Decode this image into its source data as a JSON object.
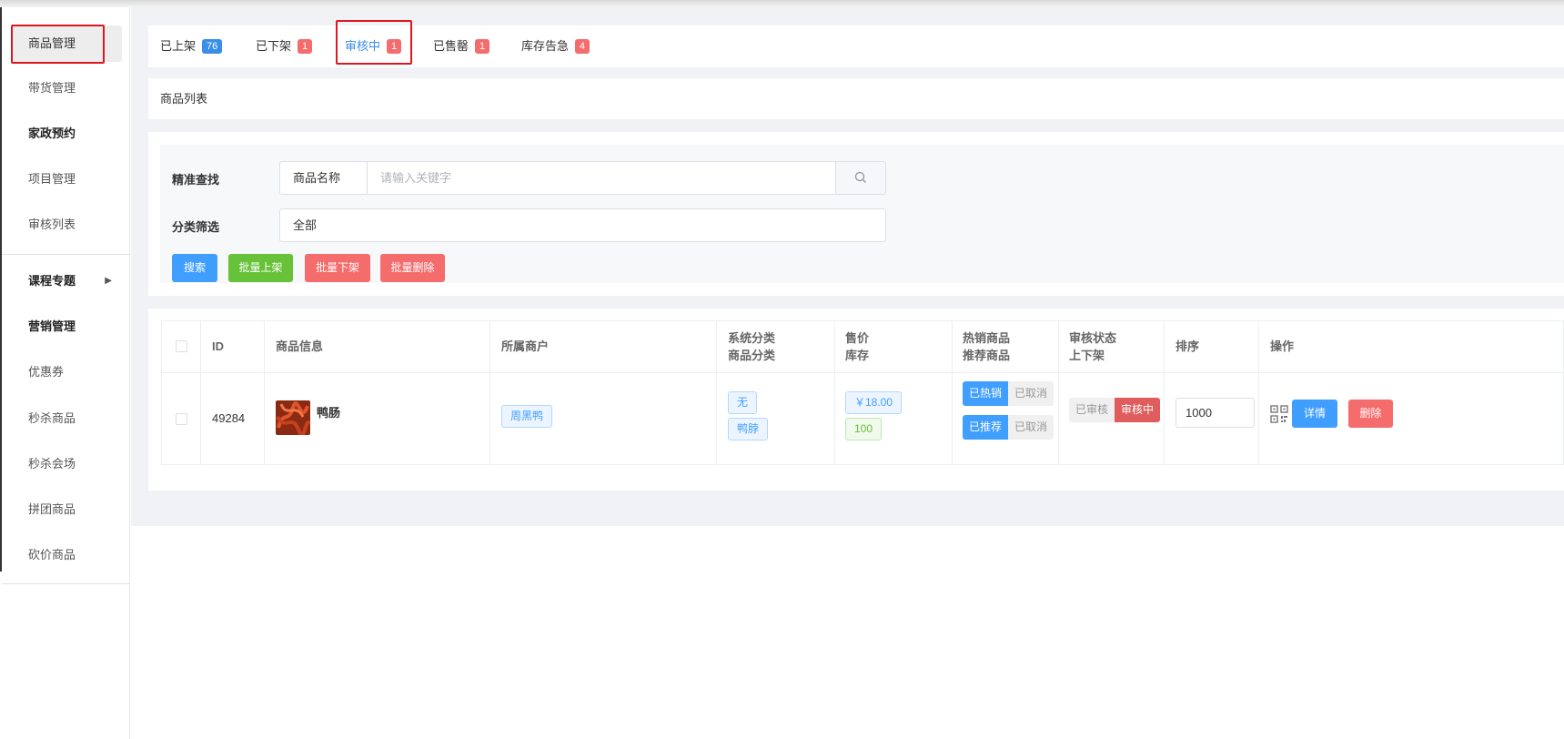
{
  "sidebar": {
    "items": [
      {
        "label": "商品管理"
      },
      {
        "label": "带货管理"
      },
      {
        "label": "家政预约"
      },
      {
        "label": "项目管理"
      },
      {
        "label": "审核列表"
      },
      {
        "label": "课程专题"
      },
      {
        "label": "营销管理"
      },
      {
        "label": "优惠券"
      },
      {
        "label": "秒杀商品"
      },
      {
        "label": "秒杀会场"
      },
      {
        "label": "拼团商品"
      },
      {
        "label": "砍价商品"
      }
    ]
  },
  "tabs": [
    {
      "label": "已上架",
      "count": "76"
    },
    {
      "label": "已下架",
      "count": "1"
    },
    {
      "label": "审核中",
      "count": "1"
    },
    {
      "label": "已售罄",
      "count": "1"
    },
    {
      "label": "库存告急",
      "count": "4"
    }
  ],
  "list_title": "商品列表",
  "filter": {
    "search_label": "精准查找",
    "field_select": "商品名称",
    "search_placeholder": "请输入关键字",
    "category_label": "分类筛选",
    "category_value": "全部",
    "buttons": {
      "search": "搜索",
      "batch_on": "批量上架",
      "batch_off": "批量下架",
      "batch_delete": "批量删除"
    }
  },
  "table": {
    "headers": {
      "id": "ID",
      "info": "商品信息",
      "merchant": "所属商户",
      "sys_cat": "系统分类",
      "goods_cat": "商品分类",
      "price": "售价",
      "stock": "库存",
      "hot": "热销商品",
      "recommend": "推荐商品",
      "audit": "审核状态",
      "shelf": "上下架",
      "sort": "排序",
      "ops": "操作"
    },
    "rows": [
      {
        "id": "49284",
        "name": "鸭肠",
        "merchant": "周黑鸭",
        "sys_cat": "无",
        "goods_cat": "鸭脖",
        "price": "￥18.00",
        "stock": "100",
        "hot_on": "已热销",
        "hot_off": "已取消",
        "rec_on": "已推荐",
        "rec_off": "已取消",
        "audit_done": "已审核",
        "audit_pending": "审核中",
        "sort": "1000",
        "detail": "详情",
        "delete": "删除"
      }
    ]
  },
  "colors": {
    "accent": "#409eff",
    "danger": "#f56c6c",
    "success": "#67c23a"
  }
}
